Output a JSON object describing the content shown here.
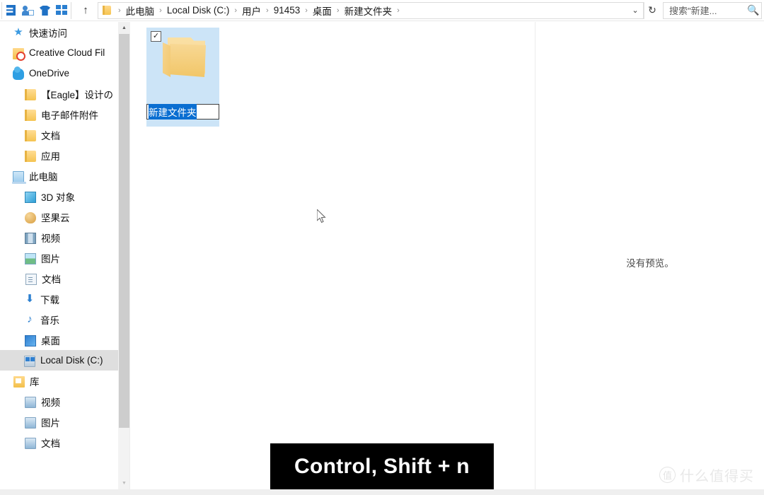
{
  "window": {
    "type": "file-explorer",
    "accent_selection": "#cce4f7",
    "accent_text_selection": "#0a6ed1"
  },
  "toolbar": {
    "quick_access_icons": [
      {
        "name": "save-icon",
        "label": "保存"
      },
      {
        "name": "properties-icon",
        "label": "属性"
      },
      {
        "name": "new-item-icon",
        "label": "新建项目"
      },
      {
        "name": "view-grid-icon",
        "label": "视图"
      }
    ],
    "up_label": "↑",
    "up_tooltip": "上移到"
  },
  "address_bar": {
    "folder_icon": "folder-icon",
    "crumbs": [
      {
        "label": "此电脑"
      },
      {
        "label": "Local Disk (C:)"
      },
      {
        "label": "用户"
      },
      {
        "label": "91453"
      },
      {
        "label": "桌面"
      },
      {
        "label": "新建文件夹"
      }
    ],
    "separator": "›",
    "history_chevron": "⌄",
    "refresh_glyph": "↻"
  },
  "search": {
    "placeholder": "搜索\"新建...",
    "value": "搜索\"新建...",
    "icon": "search-icon"
  },
  "sidebar": {
    "items": [
      {
        "label": "快速访问",
        "icon": "star-icon",
        "level": 0,
        "selected": false
      },
      {
        "label": "Creative Cloud Fil",
        "icon": "creative-cloud-icon",
        "level": 0,
        "selected": false
      },
      {
        "label": "OneDrive",
        "icon": "onedrive-icon",
        "level": 0,
        "selected": false
      },
      {
        "label": "【Eagle】设计の",
        "icon": "folder-icon",
        "level": 1,
        "selected": false
      },
      {
        "label": "电子邮件附件",
        "icon": "folder-icon",
        "level": 1,
        "selected": false
      },
      {
        "label": "文档",
        "icon": "folder-icon",
        "level": 1,
        "selected": false
      },
      {
        "label": "应用",
        "icon": "folder-icon",
        "level": 1,
        "selected": false
      },
      {
        "label": "此电脑",
        "icon": "this-pc-icon",
        "level": 0,
        "selected": false
      },
      {
        "label": "3D 对象",
        "icon": "3d-objects-icon",
        "level": 1,
        "selected": false
      },
      {
        "label": "坚果云",
        "icon": "nutstore-icon",
        "level": 1,
        "selected": false
      },
      {
        "label": "视频",
        "icon": "videos-icon",
        "level": 1,
        "selected": false
      },
      {
        "label": "图片",
        "icon": "pictures-icon",
        "level": 1,
        "selected": false
      },
      {
        "label": "文档",
        "icon": "documents-icon",
        "level": 1,
        "selected": false
      },
      {
        "label": "下载",
        "icon": "downloads-icon",
        "level": 1,
        "selected": false
      },
      {
        "label": "音乐",
        "icon": "music-icon",
        "level": 1,
        "selected": false
      },
      {
        "label": "桌面",
        "icon": "desktop-icon",
        "level": 1,
        "selected": false
      },
      {
        "label": "Local Disk (C:)",
        "icon": "local-disk-icon",
        "level": 1,
        "selected": true
      },
      {
        "label": "库",
        "icon": "library-icon",
        "level": 0,
        "selected": false
      },
      {
        "label": "视频",
        "icon": "library-videos-icon",
        "level": 1,
        "selected": false
      },
      {
        "label": "图片",
        "icon": "library-pictures-icon",
        "level": 1,
        "selected": false
      },
      {
        "label": "文档",
        "icon": "library-documents-icon",
        "level": 1,
        "selected": false
      }
    ]
  },
  "file_area": {
    "items": [
      {
        "name": "新建文件夹",
        "kind": "folder",
        "selected": true,
        "checkbox_checked": true,
        "renaming": true,
        "edit_value": "新建文件夹",
        "text_selected": true
      }
    ]
  },
  "preview_pane": {
    "message": "没有预览。"
  },
  "key_overlay": {
    "text": "Control, Shift + n"
  },
  "watermark": {
    "badge": "值",
    "text": "什么值得买"
  }
}
